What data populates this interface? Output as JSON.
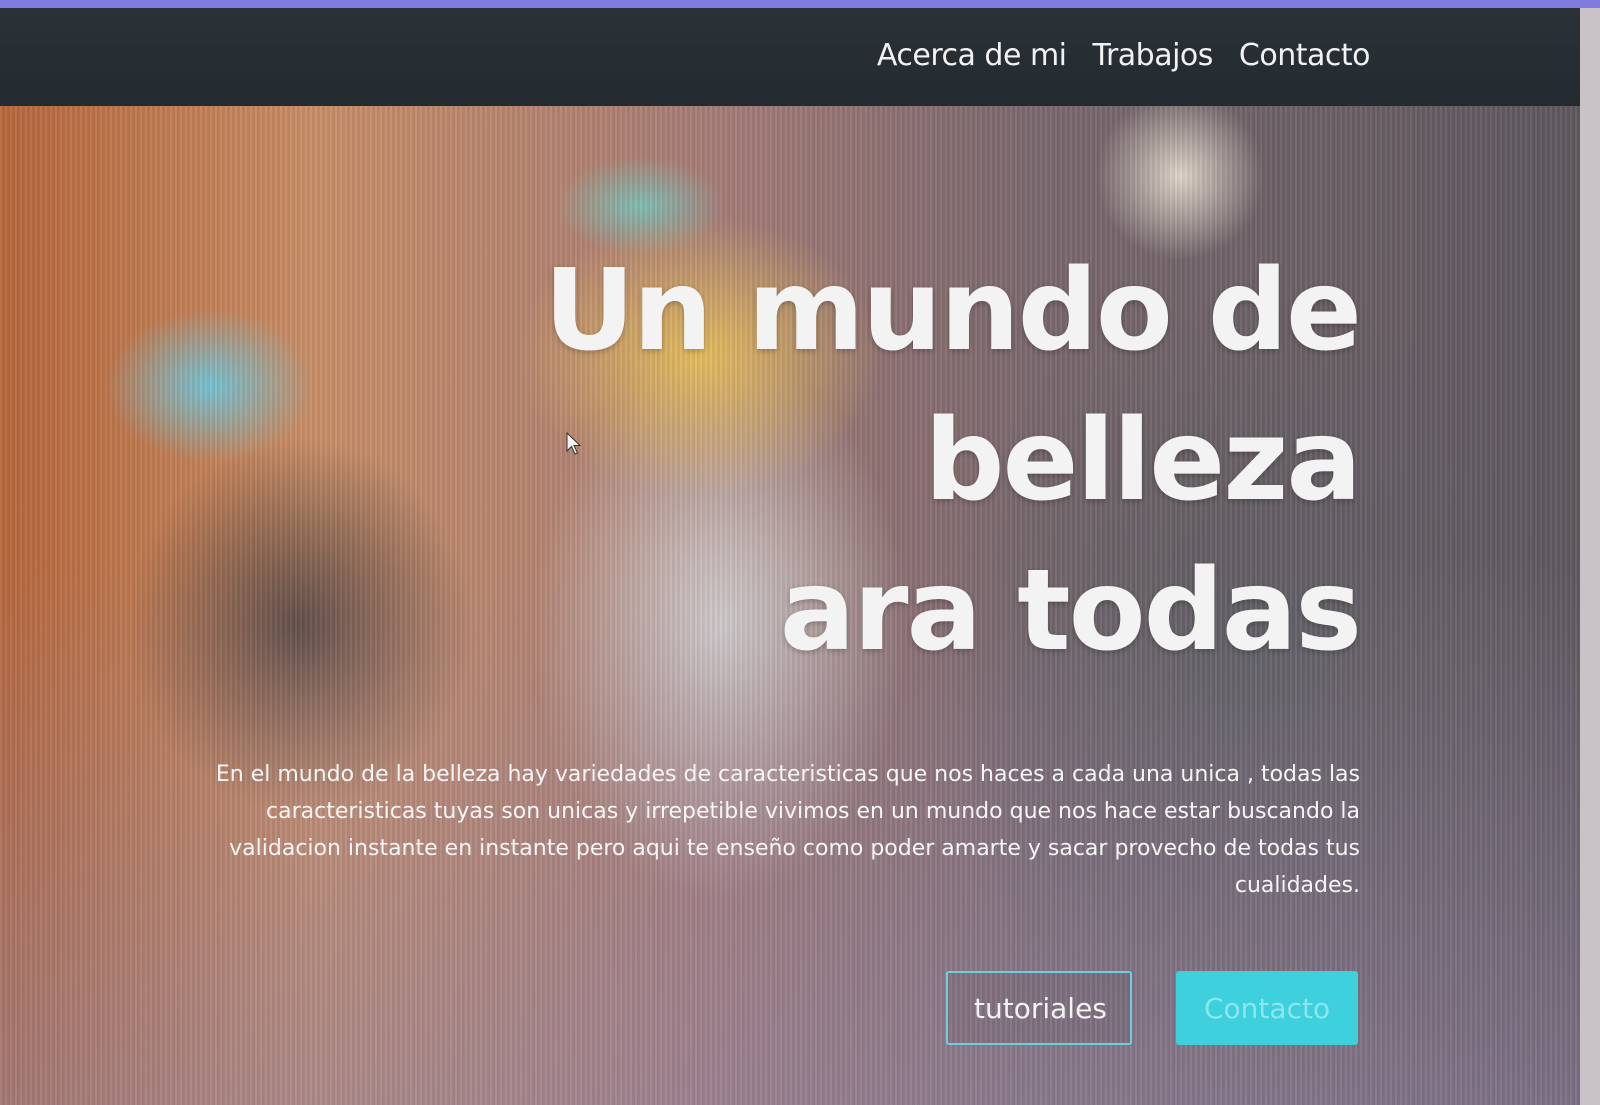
{
  "nav": {
    "links": [
      "Acerca de mi",
      "Trabajos",
      "Contacto"
    ]
  },
  "hero": {
    "title_lines": [
      "Un mundo de",
      "belleza",
      "ara todas"
    ],
    "description": "En el mundo de la belleza hay variedades de caracteristicas que nos haces a cada una unica , todas las caracteristicas tuyas son unicas y irrepetible vivimos en un mundo que nos hace estar buscando la validacion instante en instante pero aqui te enseño como poder amarte y sacar provecho de todas tus cualidades.",
    "buttons": {
      "tutorials_label": "tutoriales",
      "contact_label": "Contacto"
    }
  },
  "colors": {
    "top_strip": "#7f7ae0",
    "navbar": "#262d33",
    "accent": "#3ed0dc",
    "outline": "#6ccfe0"
  },
  "icons": {
    "cursor": "mouse-pointer-icon"
  }
}
